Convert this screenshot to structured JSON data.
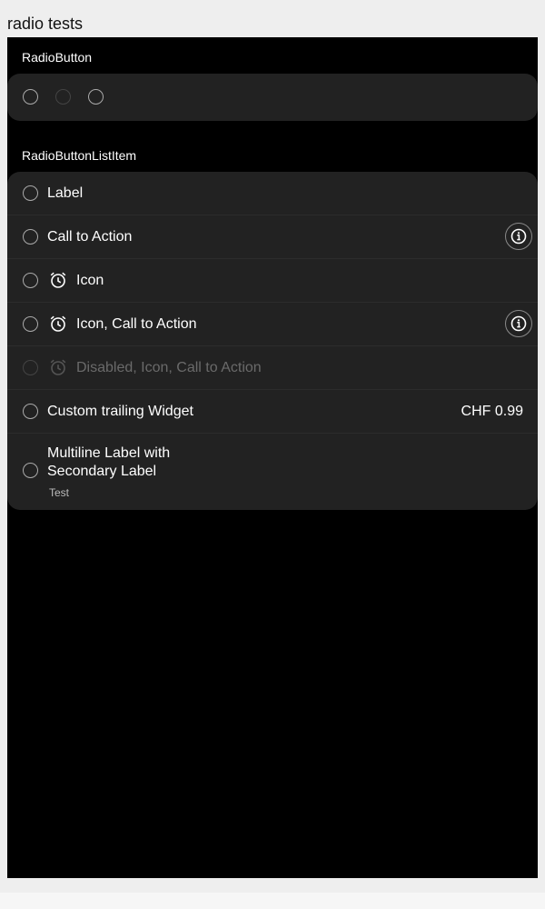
{
  "page": {
    "title": "radio tests"
  },
  "radio_button_section": {
    "title": "RadioButton",
    "radios": [
      {
        "state": "enabled"
      },
      {
        "state": "disabled"
      },
      {
        "state": "enabled"
      }
    ]
  },
  "list_section": {
    "title": "RadioButtonListItem",
    "items": [
      {
        "label": "Label",
        "icon": null,
        "trailing": null,
        "disabled": false
      },
      {
        "label": "Call to Action",
        "icon": null,
        "trailing": "info-icon",
        "disabled": false
      },
      {
        "label": "Icon",
        "icon": "alarm-clock-icon",
        "trailing": null,
        "disabled": false
      },
      {
        "label": "Icon, Call to Action",
        "icon": "alarm-clock-icon",
        "trailing": "info-icon",
        "disabled": false
      },
      {
        "label": "Disabled, Icon, Call to Action",
        "icon": "alarm-clock-icon",
        "trailing": null,
        "disabled": true
      },
      {
        "label": "Custom trailing Widget",
        "icon": null,
        "trailing_text": "CHF 0.99",
        "disabled": false
      },
      {
        "label_line1": "Multiline Label with",
        "label_line2": "Secondary Label",
        "secondary": "Test",
        "disabled": false
      }
    ]
  },
  "colors": {
    "page_background": "#eeeeee",
    "stage_background": "#000000",
    "card_background": "#222222",
    "text_primary": "#ffffff",
    "text_disabled": "#6a6a6a"
  }
}
